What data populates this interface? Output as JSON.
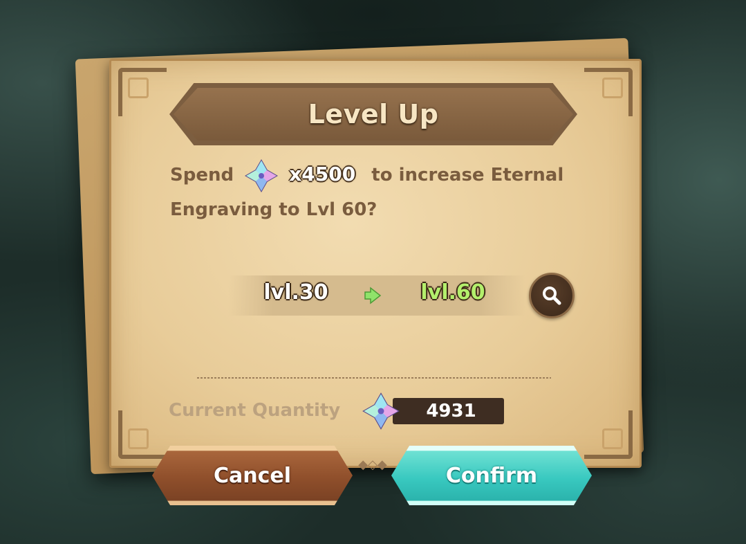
{
  "dialog": {
    "title": "Level Up",
    "message_prefix": "Spend",
    "message_amount": "x4500",
    "message_suffix": "to increase Eternal Engraving to Lvl 60?",
    "currency_icon": "crystal-shard-icon"
  },
  "level": {
    "from": "lvl.30",
    "to": "lvl.60"
  },
  "quantity": {
    "label": "Current Quantity",
    "value": "4931"
  },
  "buttons": {
    "cancel": "Cancel",
    "confirm": "Confirm"
  },
  "colors": {
    "parchment": "#e8cc99",
    "banner": "#7c5e40",
    "level_target": "#b3ef6c",
    "confirm": "#39c9c0",
    "cancel": "#8f4f2b"
  }
}
